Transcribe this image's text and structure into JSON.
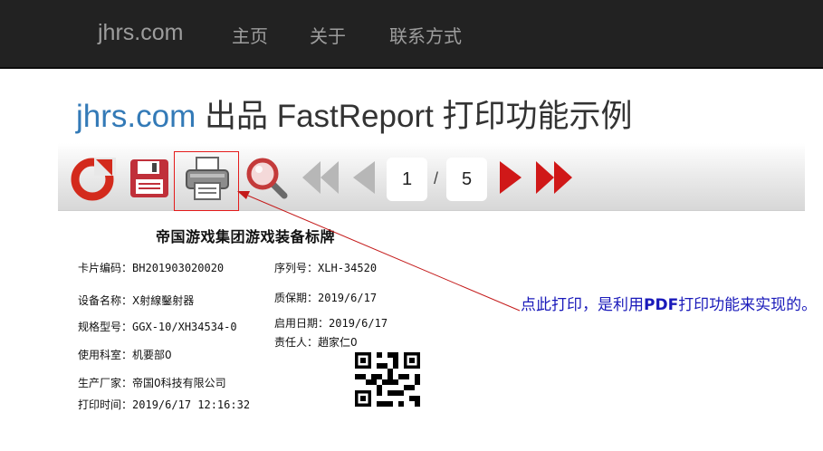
{
  "navbar": {
    "brand": "jhrs.com",
    "links": [
      "主页",
      "关于",
      "联系方式"
    ]
  },
  "page": {
    "title_accent": "jhrs.com",
    "title_rest": " 出品 FastReport 打印功能示例"
  },
  "toolbar": {
    "icons": [
      "refresh-icon",
      "save-icon",
      "print-icon",
      "zoom-icon",
      "first-page-icon",
      "prev-page-icon",
      "next-page-icon",
      "last-page-icon"
    ],
    "current_page": "1",
    "separator": "/",
    "total_pages": "5",
    "colors": {
      "refresh": "#d32a1c",
      "save": "#c0303a",
      "nav_active": "#d01818",
      "nav_disabled": "#b7b7b7",
      "highlight": "#e41b1b"
    }
  },
  "report": {
    "title": "帝国游戏集团游戏装备标牌",
    "card_no_label": "卡片编码：",
    "card_no": "BH201903020020",
    "serial_label": "序列号：",
    "serial": "XLH-34520",
    "device_label": "设备名称：",
    "device": "X射線鑿射器",
    "warranty_label": "质保期：",
    "warranty": "2019/6/17",
    "spec_label": "规格型号：",
    "spec": "GGX-10/XH34534-0",
    "start_label": "启用日期：",
    "start": "2019/6/17",
    "owner_label": "责任人：",
    "owner": "趙家仁0",
    "dept_label": "使用科室：",
    "dept": "机要部0",
    "maker_label": "生产厂家：",
    "maker": "帝国0科技有限公司",
    "print_time_label": "打印时间：",
    "print_time": "2019/6/17 12:16:32"
  },
  "annotation": {
    "part1": "点此打印，是利用",
    "part_bold": "PDF",
    "part2": "打印功能来实现的。",
    "color": "#1a1aba"
  }
}
